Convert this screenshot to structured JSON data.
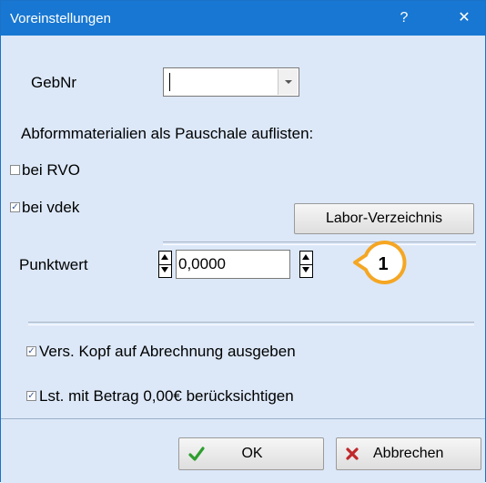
{
  "window": {
    "title": "Voreinstellungen",
    "help_glyph": "?",
    "close_glyph": "✕"
  },
  "gebnr": {
    "label": "GebNr",
    "value": ""
  },
  "abform": {
    "heading": "Abformmaterialien als Pauschale auflisten:"
  },
  "checkboxes": {
    "rvo": {
      "label": "bei RVO",
      "checked": false
    },
    "vdek": {
      "label": "bei vdek",
      "checked": true,
      "mark": "✓"
    }
  },
  "labor_button": {
    "label": "Labor-Verzeichnis"
  },
  "punktwert": {
    "label": "Punktwert",
    "value": "0,0000"
  },
  "callout": {
    "number": "1",
    "color": "#f5a623"
  },
  "options": {
    "vers_kopf": {
      "label": "Vers. Kopf auf Abrechnung ausgeben",
      "checked": true,
      "mark": "✓"
    },
    "lst_betrag": {
      "label": "Lst. mit Betrag 0,00€ berücksichtigen",
      "checked": true,
      "mark": "✓"
    }
  },
  "footer": {
    "ok": {
      "label": "OK",
      "icon": "green-check-icon"
    },
    "cancel": {
      "label": "Abbrechen",
      "icon": "red-x-icon"
    }
  },
  "colors": {
    "titlebar": "#1877d2",
    "dialog_bg": "#dce8f8",
    "accent": "#f5a623"
  }
}
